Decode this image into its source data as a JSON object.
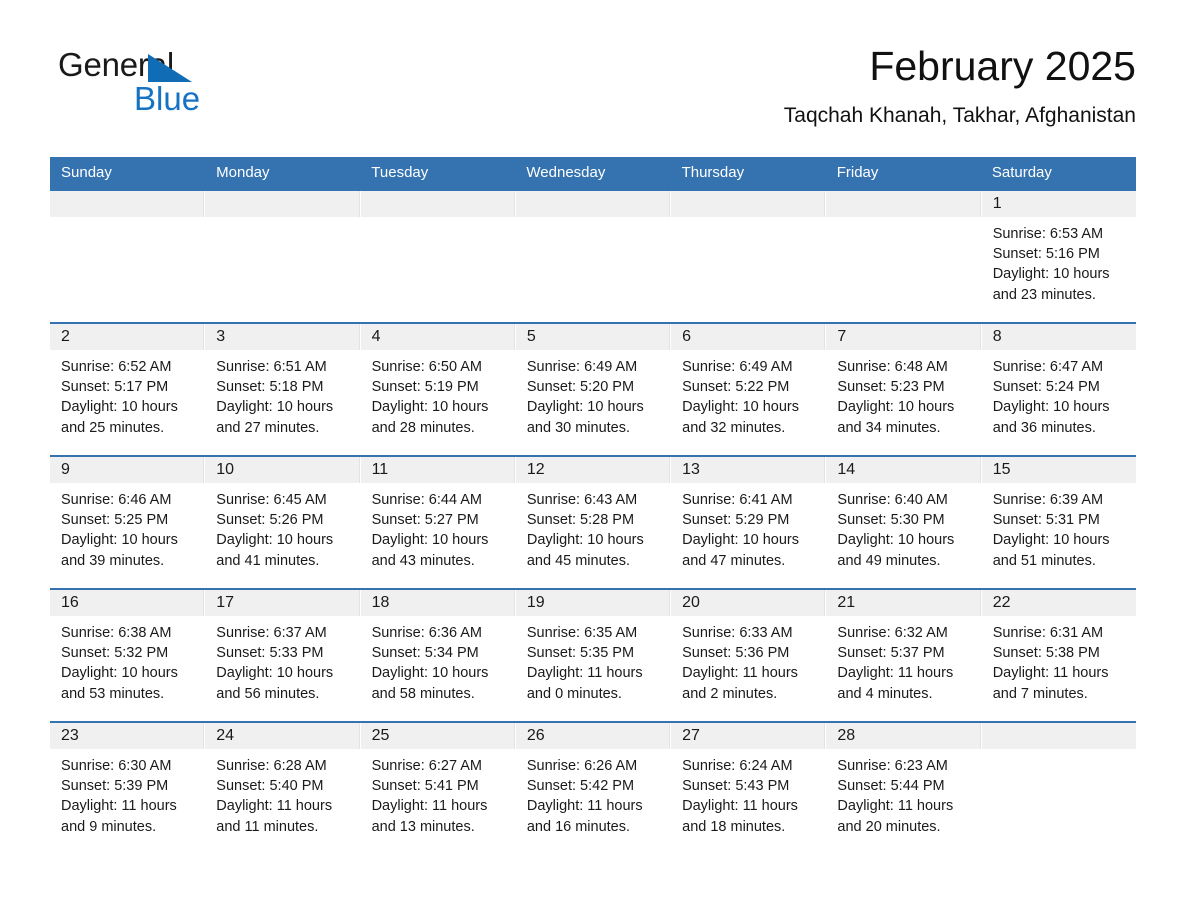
{
  "brand": {
    "name_part1": "General",
    "name_part2": "Blue",
    "triangle_color": "#0f6cb5",
    "blue_text_color": "#1673c4"
  },
  "header": {
    "title": "February 2025",
    "subtitle": "Taqchah Khanah, Takhar, Afghanistan",
    "accent_color": "#3572b0",
    "band_color": "#f0f0f0"
  },
  "weekdays": [
    "Sunday",
    "Monday",
    "Tuesday",
    "Wednesday",
    "Thursday",
    "Friday",
    "Saturday"
  ],
  "labels": {
    "sunrise_prefix": "Sunrise:",
    "sunset_prefix": "Sunset:",
    "daylight_prefix": "Daylight:"
  },
  "weeks": [
    [
      {
        "day": "",
        "l1": "",
        "l2": "",
        "l3": "",
        "l4": ""
      },
      {
        "day": "",
        "l1": "",
        "l2": "",
        "l3": "",
        "l4": ""
      },
      {
        "day": "",
        "l1": "",
        "l2": "",
        "l3": "",
        "l4": ""
      },
      {
        "day": "",
        "l1": "",
        "l2": "",
        "l3": "",
        "l4": ""
      },
      {
        "day": "",
        "l1": "",
        "l2": "",
        "l3": "",
        "l4": ""
      },
      {
        "day": "",
        "l1": "",
        "l2": "",
        "l3": "",
        "l4": ""
      },
      {
        "day": "1",
        "l1": "Sunrise: 6:53 AM",
        "l2": "Sunset: 5:16 PM",
        "l3": "Daylight: 10 hours",
        "l4": "and 23 minutes."
      }
    ],
    [
      {
        "day": "2",
        "l1": "Sunrise: 6:52 AM",
        "l2": "Sunset: 5:17 PM",
        "l3": "Daylight: 10 hours",
        "l4": "and 25 minutes."
      },
      {
        "day": "3",
        "l1": "Sunrise: 6:51 AM",
        "l2": "Sunset: 5:18 PM",
        "l3": "Daylight: 10 hours",
        "l4": "and 27 minutes."
      },
      {
        "day": "4",
        "l1": "Sunrise: 6:50 AM",
        "l2": "Sunset: 5:19 PM",
        "l3": "Daylight: 10 hours",
        "l4": "and 28 minutes."
      },
      {
        "day": "5",
        "l1": "Sunrise: 6:49 AM",
        "l2": "Sunset: 5:20 PM",
        "l3": "Daylight: 10 hours",
        "l4": "and 30 minutes."
      },
      {
        "day": "6",
        "l1": "Sunrise: 6:49 AM",
        "l2": "Sunset: 5:22 PM",
        "l3": "Daylight: 10 hours",
        "l4": "and 32 minutes."
      },
      {
        "day": "7",
        "l1": "Sunrise: 6:48 AM",
        "l2": "Sunset: 5:23 PM",
        "l3": "Daylight: 10 hours",
        "l4": "and 34 minutes."
      },
      {
        "day": "8",
        "l1": "Sunrise: 6:47 AM",
        "l2": "Sunset: 5:24 PM",
        "l3": "Daylight: 10 hours",
        "l4": "and 36 minutes."
      }
    ],
    [
      {
        "day": "9",
        "l1": "Sunrise: 6:46 AM",
        "l2": "Sunset: 5:25 PM",
        "l3": "Daylight: 10 hours",
        "l4": "and 39 minutes."
      },
      {
        "day": "10",
        "l1": "Sunrise: 6:45 AM",
        "l2": "Sunset: 5:26 PM",
        "l3": "Daylight: 10 hours",
        "l4": "and 41 minutes."
      },
      {
        "day": "11",
        "l1": "Sunrise: 6:44 AM",
        "l2": "Sunset: 5:27 PM",
        "l3": "Daylight: 10 hours",
        "l4": "and 43 minutes."
      },
      {
        "day": "12",
        "l1": "Sunrise: 6:43 AM",
        "l2": "Sunset: 5:28 PM",
        "l3": "Daylight: 10 hours",
        "l4": "and 45 minutes."
      },
      {
        "day": "13",
        "l1": "Sunrise: 6:41 AM",
        "l2": "Sunset: 5:29 PM",
        "l3": "Daylight: 10 hours",
        "l4": "and 47 minutes."
      },
      {
        "day": "14",
        "l1": "Sunrise: 6:40 AM",
        "l2": "Sunset: 5:30 PM",
        "l3": "Daylight: 10 hours",
        "l4": "and 49 minutes."
      },
      {
        "day": "15",
        "l1": "Sunrise: 6:39 AM",
        "l2": "Sunset: 5:31 PM",
        "l3": "Daylight: 10 hours",
        "l4": "and 51 minutes."
      }
    ],
    [
      {
        "day": "16",
        "l1": "Sunrise: 6:38 AM",
        "l2": "Sunset: 5:32 PM",
        "l3": "Daylight: 10 hours",
        "l4": "and 53 minutes."
      },
      {
        "day": "17",
        "l1": "Sunrise: 6:37 AM",
        "l2": "Sunset: 5:33 PM",
        "l3": "Daylight: 10 hours",
        "l4": "and 56 minutes."
      },
      {
        "day": "18",
        "l1": "Sunrise: 6:36 AM",
        "l2": "Sunset: 5:34 PM",
        "l3": "Daylight: 10 hours",
        "l4": "and 58 minutes."
      },
      {
        "day": "19",
        "l1": "Sunrise: 6:35 AM",
        "l2": "Sunset: 5:35 PM",
        "l3": "Daylight: 11 hours",
        "l4": "and 0 minutes."
      },
      {
        "day": "20",
        "l1": "Sunrise: 6:33 AM",
        "l2": "Sunset: 5:36 PM",
        "l3": "Daylight: 11 hours",
        "l4": "and 2 minutes."
      },
      {
        "day": "21",
        "l1": "Sunrise: 6:32 AM",
        "l2": "Sunset: 5:37 PM",
        "l3": "Daylight: 11 hours",
        "l4": "and 4 minutes."
      },
      {
        "day": "22",
        "l1": "Sunrise: 6:31 AM",
        "l2": "Sunset: 5:38 PM",
        "l3": "Daylight: 11 hours",
        "l4": "and 7 minutes."
      }
    ],
    [
      {
        "day": "23",
        "l1": "Sunrise: 6:30 AM",
        "l2": "Sunset: 5:39 PM",
        "l3": "Daylight: 11 hours",
        "l4": "and 9 minutes."
      },
      {
        "day": "24",
        "l1": "Sunrise: 6:28 AM",
        "l2": "Sunset: 5:40 PM",
        "l3": "Daylight: 11 hours",
        "l4": "and 11 minutes."
      },
      {
        "day": "25",
        "l1": "Sunrise: 6:27 AM",
        "l2": "Sunset: 5:41 PM",
        "l3": "Daylight: 11 hours",
        "l4": "and 13 minutes."
      },
      {
        "day": "26",
        "l1": "Sunrise: 6:26 AM",
        "l2": "Sunset: 5:42 PM",
        "l3": "Daylight: 11 hours",
        "l4": "and 16 minutes."
      },
      {
        "day": "27",
        "l1": "Sunrise: 6:24 AM",
        "l2": "Sunset: 5:43 PM",
        "l3": "Daylight: 11 hours",
        "l4": "and 18 minutes."
      },
      {
        "day": "28",
        "l1": "Sunrise: 6:23 AM",
        "l2": "Sunset: 5:44 PM",
        "l3": "Daylight: 11 hours",
        "l4": "and 20 minutes."
      },
      {
        "day": "",
        "l1": "",
        "l2": "",
        "l3": "",
        "l4": ""
      }
    ]
  ]
}
